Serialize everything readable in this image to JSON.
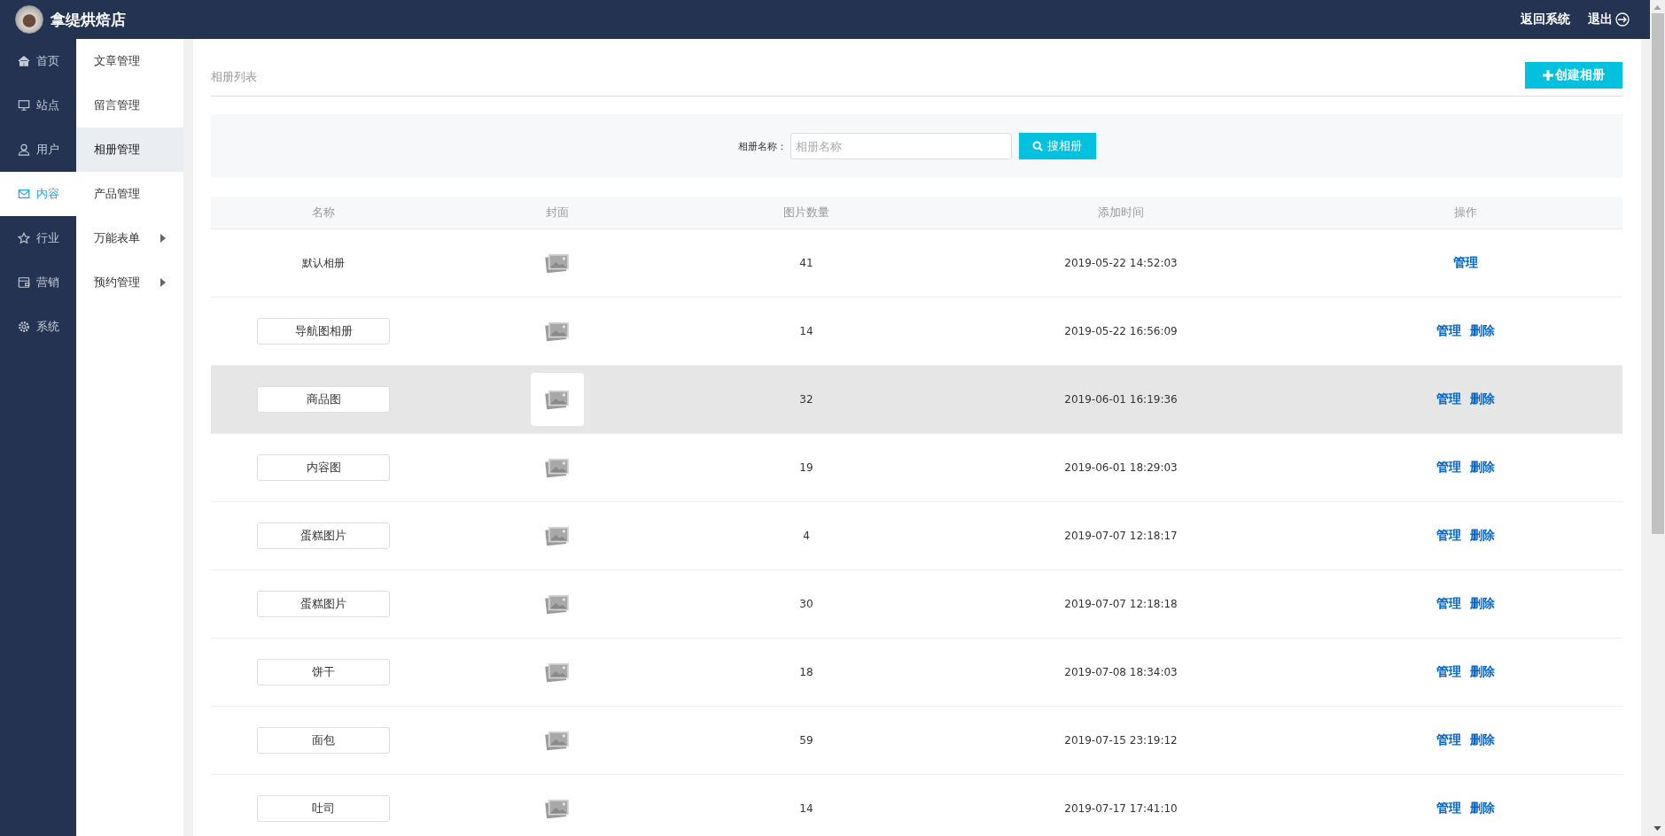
{
  "header": {
    "shop_name": "拿缇烘焙店",
    "links": [
      "返回系统",
      "退出"
    ]
  },
  "main_nav": [
    {
      "label": "首页",
      "selected": false
    },
    {
      "label": "站点",
      "selected": false
    },
    {
      "label": "用户",
      "selected": false
    },
    {
      "label": "内容",
      "selected": true
    },
    {
      "label": "行业",
      "selected": false
    },
    {
      "label": "营销",
      "selected": false
    },
    {
      "label": "系统",
      "selected": false
    }
  ],
  "sub_nav": [
    {
      "label": "文章管理",
      "selected": false,
      "kind": "link"
    },
    {
      "label": "留言管理",
      "selected": false,
      "kind": "link"
    },
    {
      "label": "相册管理",
      "selected": true,
      "kind": "link"
    },
    {
      "label": "产品管理",
      "selected": false,
      "kind": "link"
    },
    {
      "label": "万能表单",
      "selected": false,
      "kind": "submenu"
    },
    {
      "label": "预约管理",
      "selected": false,
      "kind": "submenu"
    }
  ],
  "page_title": "相册列表",
  "create_button": "创建相册",
  "search": {
    "label": "相册名称：",
    "placeholder": "相册名称",
    "button": "搜相册"
  },
  "table": {
    "columns": [
      "名称",
      "封面",
      "图片数量",
      "添加时间",
      "操作"
    ],
    "rows": [
      {
        "name": "默认相册",
        "kind": "text",
        "count": "41",
        "added": "2019-05-22 14:52:03",
        "highlighted": false,
        "actions": [
          "管理"
        ]
      },
      {
        "name": "导航图相册",
        "kind": "field",
        "count": "14",
        "added": "2019-05-22 16:56:09",
        "highlighted": false,
        "actions": [
          "管理",
          "删除"
        ]
      },
      {
        "name": "商品图",
        "kind": "field",
        "count": "32",
        "added": "2019-06-01 16:19:36",
        "highlighted": true,
        "actions": [
          "管理",
          "删除"
        ]
      },
      {
        "name": "内容图",
        "kind": "field",
        "count": "19",
        "added": "2019-06-01 18:29:03",
        "highlighted": false,
        "actions": [
          "管理",
          "删除"
        ]
      },
      {
        "name": "蛋糕图片",
        "kind": "field",
        "count": "4",
        "added": "2019-07-07 12:18:17",
        "highlighted": false,
        "actions": [
          "管理",
          "删除"
        ]
      },
      {
        "name": "蛋糕图片",
        "kind": "field",
        "count": "30",
        "added": "2019-07-07 12:18:18",
        "highlighted": false,
        "actions": [
          "管理",
          "删除"
        ]
      },
      {
        "name": "饼干",
        "kind": "field",
        "count": "18",
        "added": "2019-07-08 18:34:03",
        "highlighted": false,
        "actions": [
          "管理",
          "删除"
        ]
      },
      {
        "name": "面包",
        "kind": "field",
        "count": "59",
        "added": "2019-07-15 23:19:12",
        "highlighted": false,
        "actions": [
          "管理",
          "删除"
        ]
      },
      {
        "name": "吐司",
        "kind": "field",
        "count": "14",
        "added": "2019-07-17 17:41:10",
        "highlighted": false,
        "actions": [
          "管理",
          "删除"
        ]
      }
    ]
  }
}
